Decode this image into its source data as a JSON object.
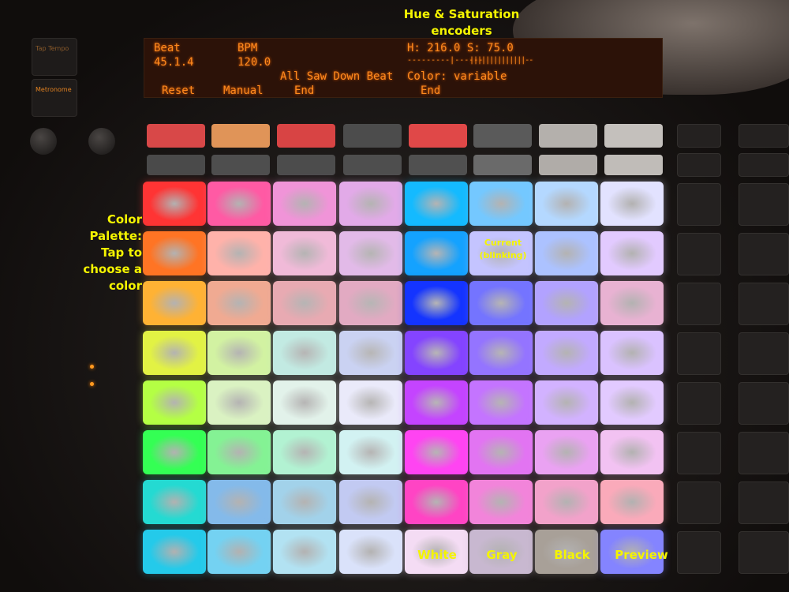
{
  "side_buttons": {
    "tap_tempo": "Tap Tempo",
    "metronome": "Metronome"
  },
  "display": {
    "beat_label": "Beat",
    "bpm_label": "BPM",
    "beat_value": "45.1.4",
    "bpm_value": "120.0",
    "hs_readout": "H: 216.0 S: 75.0",
    "hue_bar": "---------|------",
    "sat_bar": "||||||||||||||--",
    "mode_text": "All Saw Down Beat",
    "color_text": "Color: variable",
    "soft_labels": [
      "Reset",
      "Manual",
      "End",
      "End"
    ]
  },
  "annotations": {
    "encoders": "Hue & Saturation encoders",
    "palette": "Color Palette: Tap to choose a color",
    "current": "Current (blinking)"
  },
  "top_row_colors": [
    "#d84848",
    "#e09458",
    "#d84444",
    "#4c4c4c",
    "#e04848",
    "#5a5a5a",
    "#b4b0ac",
    "#c4c0bc"
  ],
  "second_row_colors": [
    "#4a4a4a",
    "#4e4e4e",
    "#4c4c4c",
    "#4e4e4e",
    "#505050",
    "#6a6a6a",
    "#b0aca8",
    "#c0bcb8"
  ],
  "pads": [
    [
      "#ff3434",
      "#ff5aa4",
      "#f094d8",
      "#e2aae8",
      "#14baff",
      "#74c8ff",
      "#b4d8ff",
      "#e2e2ff"
    ],
    [
      "#ff7424",
      "#ffb2aa",
      "#f0bad8",
      "#e2bae8",
      "#14a2ff",
      "#c4c4ff",
      "#acc2ff",
      "#e2caff"
    ],
    [
      "#ffb234",
      "#f0aa92",
      "#e8aab2",
      "#e2aac2",
      "#1434ff",
      "#7474ff",
      "#b2a2ff",
      "#e8b2d2"
    ],
    [
      "#e2f244",
      "#d2f2a2",
      "#c2eae2",
      "#cad2f2",
      "#8444ff",
      "#9474ff",
      "#c2aaff",
      "#dac2ff"
    ],
    [
      "#b4ff44",
      "#daf2c2",
      "#e2f2ea",
      "#eaeafa",
      "#c444ff",
      "#c474ff",
      "#d2b2ff",
      "#e2caff"
    ],
    [
      "#34ff54",
      "#84f294",
      "#b2f2d2",
      "#d2f2f2",
      "#ff44f2",
      "#e274f2",
      "#eaa2f2",
      "#f2c2f2"
    ],
    [
      "#24dad2",
      "#84baea",
      "#a2d2ea",
      "#c2caf2",
      "#ff44c4",
      "#f284da",
      "#f2a2ca",
      "#faaaba"
    ],
    [
      "#24caea",
      "#74d2f2",
      "#b2e2f2",
      "#dae2fa",
      "#f4dcf4",
      "#c8b8d0",
      "#a8a098",
      "#8484ff"
    ]
  ],
  "pad_labels": {
    "white": "White",
    "gray": "Gray",
    "black": "Black",
    "preview": "Preview"
  }
}
